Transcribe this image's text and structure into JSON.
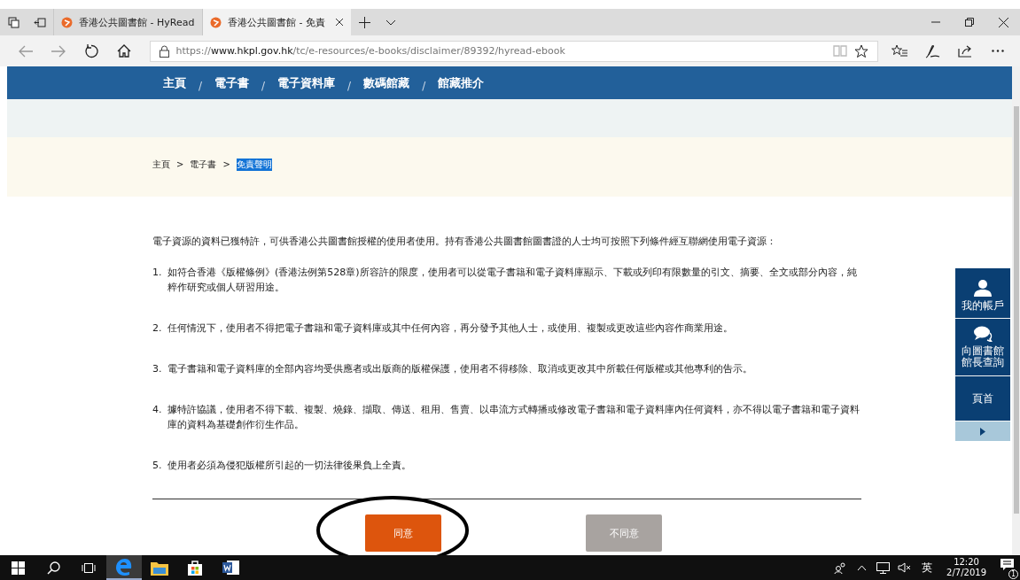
{
  "browser": {
    "tabs": [
      {
        "title": "香港公共圖書館 - HyRead",
        "selected": false
      },
      {
        "title": "香港公共圖書館 - 免責",
        "selected": true
      }
    ],
    "address": {
      "scheme": "https://",
      "host": "www.hkpl.gov.hk",
      "path": "/tc/e-resources/e-books/disclaimer/89392/hyread-ebook"
    }
  },
  "nav": {
    "items": [
      "主頁",
      "電子書",
      "電子資料庫",
      "數碼館藏",
      "館藏推介"
    ],
    "separator": "/"
  },
  "breadcrumb": {
    "separator": ">",
    "items": [
      {
        "label": "主頁",
        "selected": false
      },
      {
        "label": "電子書",
        "selected": false
      },
      {
        "label": "免責聲明",
        "selected": true
      }
    ]
  },
  "intro": "電子資源的資料已獲特許，可供香港公共圖書館授權的使用者使用。持有香港公共圖書館圖書證的人士均可按照下列條件經互聯網使用電子資源：",
  "terms": [
    {
      "number": "1.",
      "text": "如符合香港《版權條例》(香港法例第528章)所容許的限度，使用者可以從電子書籍和電子資料庫顯示、下載或列印有限數量的引文、摘要、全文或部分內容，純粹作研究或個人研習用途。"
    },
    {
      "number": "2.",
      "text": "任何情況下，使用者不得把電子書籍和電子資料庫或其中任何內容，再分發予其他人士，或使用、複製或更改這些內容作商業用途。"
    },
    {
      "number": "3.",
      "text": "電子書籍和電子資料庫的全部內容均受供應者或出版商的版權保護，使用者不得移除、取消或更改其中所載任何版權或其他專利的告示。"
    },
    {
      "number": "4.",
      "text": "據特許協議，使用者不得下載、複製、燒錄、擷取、傳送、租用、售賣、以串流方式轉播或修改電子書籍和電子資料庫內任何資料，亦不得以電子書籍和電子資料庫的資料為基礎創作衍生作品。"
    },
    {
      "number": "5.",
      "text": "使用者必須為侵犯版權所引起的一切法律後果負上全責。"
    }
  ],
  "buttons": [
    {
      "label": "同意",
      "kind": "agree"
    },
    {
      "label": "不同意",
      "kind": "disagree"
    }
  ],
  "side_panel": [
    {
      "label": "我的帳戶",
      "kind": "account"
    },
    {
      "label": "向圖書館館長查詢",
      "kind": "chat"
    },
    {
      "label": "頁首",
      "kind": "top"
    },
    {
      "kind": "expand"
    }
  ],
  "taskbar": {
    "apps": [
      {
        "kind": "edge",
        "selected": true
      },
      {
        "kind": "folder",
        "selected": false
      },
      {
        "kind": "store",
        "selected": false
      },
      {
        "kind": "word",
        "selected": false
      }
    ],
    "ime": "英",
    "time": "12:20",
    "date": "2/7/2019",
    "notifications": "1"
  }
}
